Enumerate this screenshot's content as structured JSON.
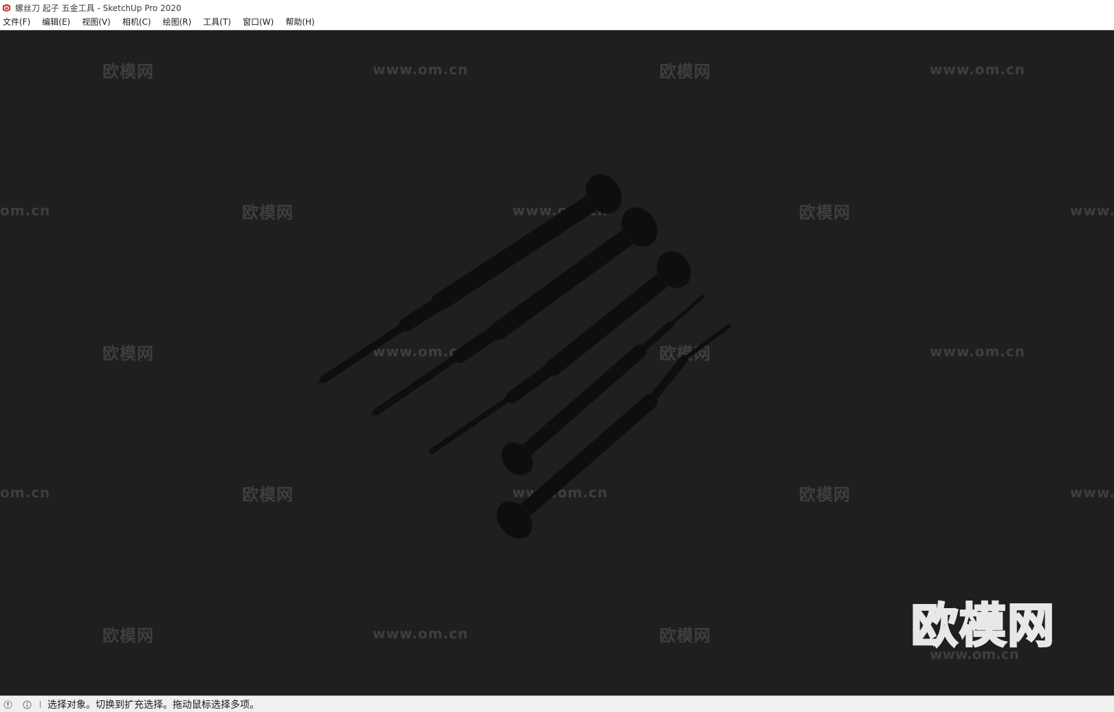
{
  "window": {
    "title": "螺丝刀 起子 五金工具 - SketchUp Pro 2020",
    "app_icon": "sketchup-logo-icon"
  },
  "menu": {
    "items": [
      {
        "label": "文件(F)"
      },
      {
        "label": "编辑(E)"
      },
      {
        "label": "视图(V)"
      },
      {
        "label": "相机(C)"
      },
      {
        "label": "绘图(R)"
      },
      {
        "label": "工具(T)"
      },
      {
        "label": "窗口(W)"
      },
      {
        "label": "帮助(H)"
      }
    ]
  },
  "viewport": {
    "background": "#1f1f1f",
    "model_color": "#0e0e0e",
    "watermark_logo_text": "欧模网",
    "watermark_url_text": "www.om.cn",
    "watermark_url_cropped": "www.",
    "watermark_url_left_cropped": "om.cn"
  },
  "status": {
    "icons": [
      "geo-location-icon",
      "info-icon"
    ],
    "message": "选择对象。切换到扩充选择。拖动鼠标选择多项。"
  }
}
